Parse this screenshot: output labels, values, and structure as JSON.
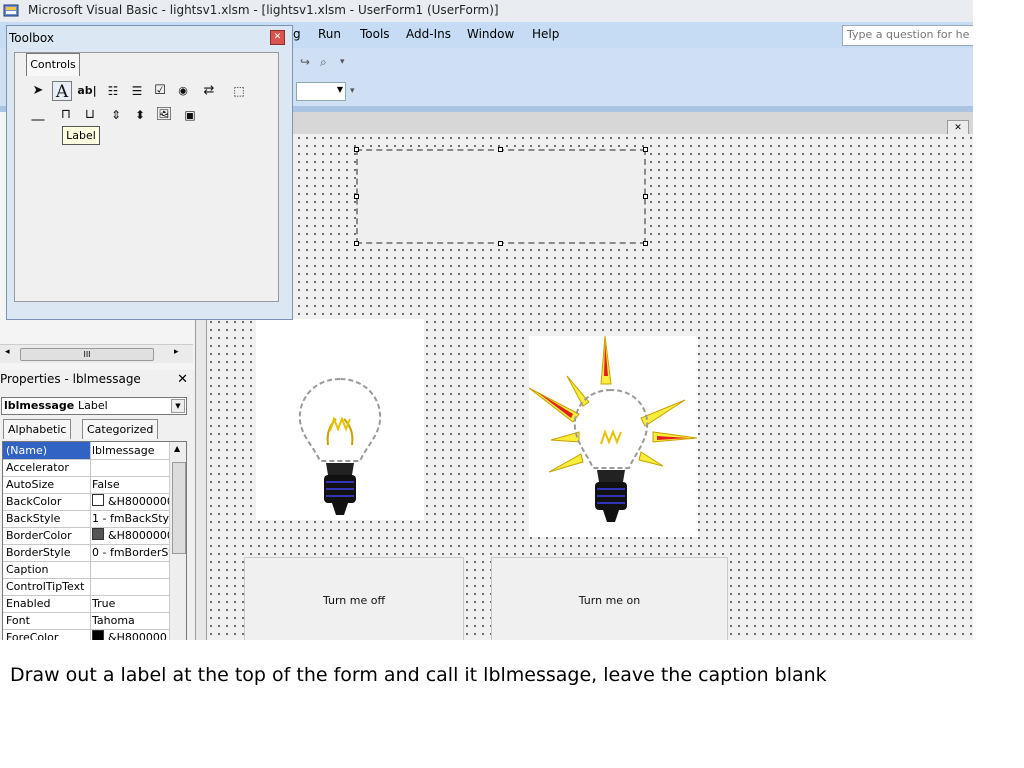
{
  "window": {
    "title": "Microsoft Visual Basic - lightsv1.xlsm - [lightsv1.xlsm - UserForm1 (UserForm)]"
  },
  "menu": {
    "items": [
      "g",
      "Run",
      "Tools",
      "Add-Ins",
      "Window",
      "Help"
    ],
    "ask_placeholder": "Type a question for he"
  },
  "toolbox": {
    "title": "Toolbox",
    "tab_label": "Controls",
    "tooltip": "Label",
    "row1_tools": [
      "pointer-tool",
      "label-tool",
      "textbox-tool",
      "combobox-tool",
      "listbox-tool",
      "checkbox-tool",
      "optionbutton-tool",
      "togglebutton-tool",
      "frame-tool"
    ],
    "row2_tools": [
      "commandbutton-tool",
      "tabstrip-tool",
      "multipage-tool",
      "scrollbar-tool",
      "spinbutton-tool",
      "image-tool",
      "refedit-tool"
    ]
  },
  "properties": {
    "title": "Properties - lblmessage",
    "close": "✕",
    "object_name": "lblmessage",
    "object_type": "Label",
    "tabs": [
      "Alphabetic",
      "Categorized"
    ],
    "rows": [
      {
        "name": "(Name)",
        "value": "lblmessage"
      },
      {
        "name": "Accelerator",
        "value": ""
      },
      {
        "name": "AutoSize",
        "value": "False"
      },
      {
        "name": "BackColor",
        "value": "&H8000000(",
        "swatch": "#ffffff"
      },
      {
        "name": "BackStyle",
        "value": "1 - fmBackStyl"
      },
      {
        "name": "BorderColor",
        "value": "&H8000000(",
        "swatch": "#555555"
      },
      {
        "name": "BorderStyle",
        "value": "0 - fmBorderSt"
      },
      {
        "name": "Caption",
        "value": ""
      },
      {
        "name": "ControlTipText",
        "value": ""
      },
      {
        "name": "Enabled",
        "value": "True"
      },
      {
        "name": "Font",
        "value": "Tahoma"
      },
      {
        "name": "ForeColor",
        "value": "&H800000",
        "swatch": "#000000"
      }
    ]
  },
  "project_pane": {
    "scroll_thumb": "III"
  },
  "form": {
    "close_glyph": "✕",
    "buttons": {
      "off_label": "Turn me off",
      "on_label": "Turn me on"
    }
  },
  "instruction": "Draw out a label at the top of the form and call it lblmessage, leave the caption blank",
  "colors": {
    "menubar": "#c6dcf4",
    "selection": "#3163c5",
    "tooltip": "#ffffe1"
  }
}
